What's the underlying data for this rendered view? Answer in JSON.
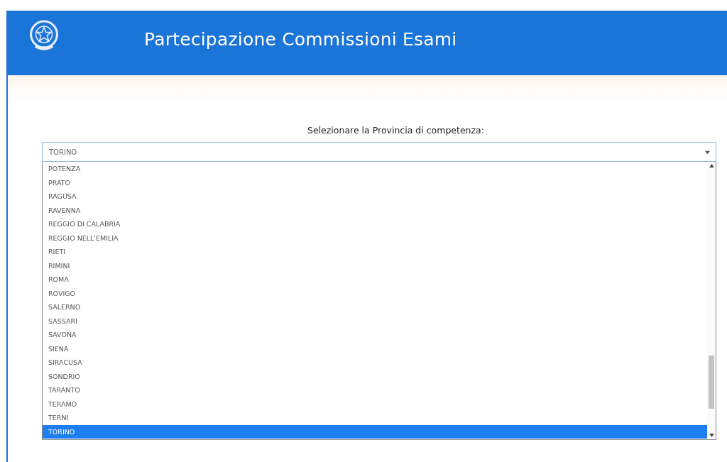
{
  "header": {
    "title": "Partecipazione Commissioni Esami"
  },
  "province_select": {
    "label": "Selezionare la Provincia di competenza:",
    "value": "TORINO",
    "options": [
      {
        "label": "POTENZA",
        "selected": false
      },
      {
        "label": "PRATO",
        "selected": false
      },
      {
        "label": "RAGUSA",
        "selected": false
      },
      {
        "label": "RAVENNA",
        "selected": false
      },
      {
        "label": "REGGIO DI CALABRIA",
        "selected": false
      },
      {
        "label": "REGGIO NELL'EMILIA",
        "selected": false
      },
      {
        "label": "RIETI",
        "selected": false
      },
      {
        "label": "RIMINI",
        "selected": false
      },
      {
        "label": "ROMA",
        "selected": false
      },
      {
        "label": "ROVIGO",
        "selected": false
      },
      {
        "label": "SALERNO",
        "selected": false
      },
      {
        "label": "SASSARI",
        "selected": false
      },
      {
        "label": "SAVONA",
        "selected": false
      },
      {
        "label": "SIENA",
        "selected": false
      },
      {
        "label": "SIRACUSA",
        "selected": false
      },
      {
        "label": "SONDRIO",
        "selected": false
      },
      {
        "label": "TARANTO",
        "selected": false
      },
      {
        "label": "TERAMO",
        "selected": false
      },
      {
        "label": "TERNI",
        "selected": false
      },
      {
        "label": "TORINO",
        "selected": true
      }
    ]
  }
}
